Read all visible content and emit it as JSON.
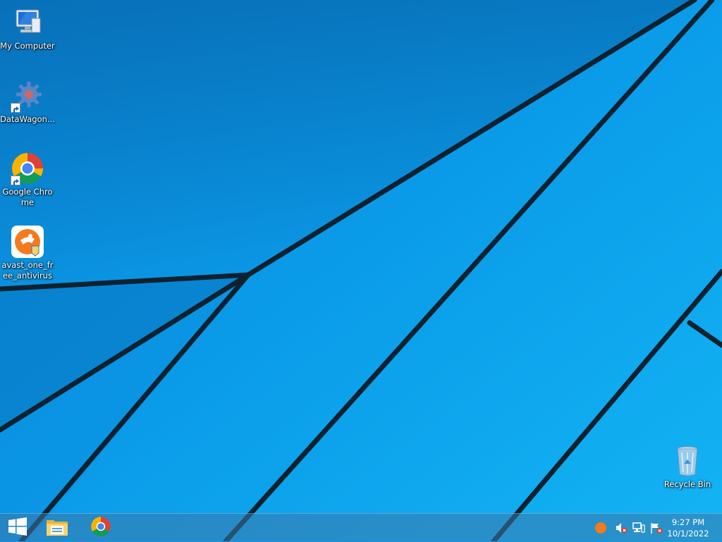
{
  "desktop": {
    "icons": [
      {
        "label": "My Computer",
        "icon": "computer-icon",
        "shortcut": false
      },
      {
        "label": "DataWagon...",
        "icon": "gear-icon",
        "shortcut": true
      },
      {
        "label": "Google Chrome",
        "icon": "chrome-icon",
        "shortcut": true
      },
      {
        "label": "avast_one_free_antivirus",
        "icon": "avast-icon",
        "shortcut": true
      },
      {
        "label": "Recycle Bin",
        "icon": "recycle-bin-icon",
        "shortcut": false
      }
    ]
  },
  "taskbar": {
    "pinned": [
      {
        "name": "start-button",
        "icon": "windows-logo-icon"
      },
      {
        "name": "file-explorer",
        "icon": "folder-icon"
      },
      {
        "name": "chrome",
        "icon": "chrome-icon"
      }
    ],
    "tray": [
      {
        "icon": "avast-tray-icon"
      },
      {
        "icon": "volume-muted-icon"
      },
      {
        "icon": "network-icon"
      },
      {
        "icon": "action-center-flag-icon"
      }
    ],
    "clock": {
      "time": "9:27 PM",
      "date": "10/1/2022"
    }
  },
  "colors": {
    "wallpaper": "#0a9cea",
    "accent_dark": "#0b5c9a",
    "line": "#0d2230"
  }
}
